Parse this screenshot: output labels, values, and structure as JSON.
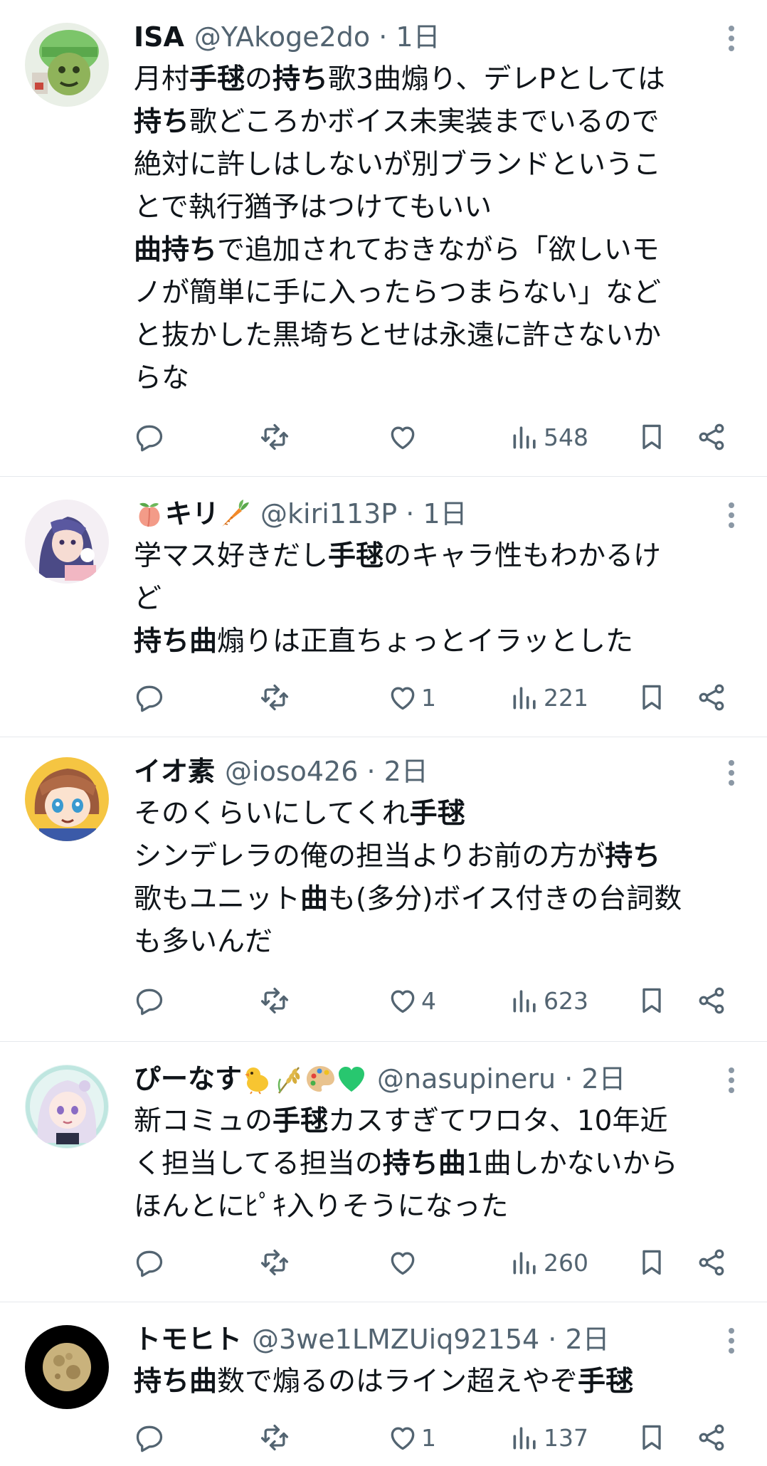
{
  "posts": [
    {
      "name": "ISA",
      "handle": "@YAkoge2do",
      "time": "1日",
      "text_lines": [
        [
          {
            "t": "月村"
          },
          {
            "t": "手毬",
            "b": true
          },
          {
            "t": "の"
          },
          {
            "t": "持ち",
            "b": true
          },
          {
            "t": "歌3曲煽り、デレPとしては"
          }
        ],
        [
          {
            "t": "持ち",
            "b": true
          },
          {
            "t": "歌どころかボイス未実装までいるので"
          }
        ],
        [
          {
            "t": "絶対に許しはしないが別ブランドというこ"
          }
        ],
        [
          {
            "t": "とで執行猶予はつけてもいい"
          }
        ],
        [
          {
            "t": "曲持ち",
            "b": true
          },
          {
            "t": "で追加されておきながら「欲しいモ"
          }
        ],
        [
          {
            "t": "ノが簡単に手に入ったらつまらない」など"
          }
        ],
        [
          {
            "t": "と抜かした黒埼ちとせは永遠に許さないか"
          }
        ],
        [
          {
            "t": "らな"
          }
        ]
      ],
      "likes": "",
      "views": "548"
    },
    {
      "name": "キリ",
      "name_prefix_emoji": "peach-emoji",
      "name_suffix_emoji": "carrot-emoji",
      "handle": "@kiri113P",
      "time": "1日",
      "text_lines": [
        [
          {
            "t": "学マス好きだし"
          },
          {
            "t": "手毬",
            "b": true
          },
          {
            "t": "のキャラ性もわかるけ"
          }
        ],
        [
          {
            "t": "ど"
          }
        ],
        [
          {
            "t": "持ち曲",
            "b": true
          },
          {
            "t": "煽りは正直ちょっとイラッとした"
          }
        ]
      ],
      "likes": "1",
      "views": "221"
    },
    {
      "name": "イオ素",
      "handle": "@ioso426",
      "time": "2日",
      "text_lines": [
        [
          {
            "t": "そのくらいにしてくれ"
          },
          {
            "t": "手毬",
            "b": true
          }
        ],
        [
          {
            "t": "シンデレラの俺の担当よりお前の方が"
          },
          {
            "t": "持ち",
            "b": true
          }
        ],
        [
          {
            "t": "歌もユニット"
          },
          {
            "t": "曲",
            "b": true
          },
          {
            "t": "も(多分)ボイス付きの台詞数"
          }
        ],
        [
          {
            "t": "も多いんだ"
          }
        ]
      ],
      "likes": "4",
      "views": "623"
    },
    {
      "name": "ぴーなす",
      "name_suffix_emojis": [
        "chick-emoji",
        "rice-emoji",
        "palette-emoji",
        "green-heart-emoji"
      ],
      "handle": "@nasupineru",
      "time": "2日",
      "text_lines": [
        [
          {
            "t": "新コミュの"
          },
          {
            "t": "手毬",
            "b": true
          },
          {
            "t": "カスすぎてワロタ、10年近"
          }
        ],
        [
          {
            "t": "く担当してる担当の"
          },
          {
            "t": "持ち曲",
            "b": true
          },
          {
            "t": "1曲しかないから"
          }
        ],
        [
          {
            "t": "ほんとにﾋﾟｷ入りそうになった"
          }
        ]
      ],
      "likes": "",
      "views": "260"
    },
    {
      "name": "トモヒト",
      "handle": "@3we1LMZUiq92154",
      "time": "2日",
      "text_lines": [
        [
          {
            "t": "持ち曲",
            "b": true
          },
          {
            "t": "数で煽るのはライン超えやぞ"
          },
          {
            "t": "手毬",
            "b": true
          }
        ]
      ],
      "likes": "1",
      "views": "137"
    }
  ],
  "colors": {
    "text": "#0f1419",
    "secondary": "#536471",
    "divider": "#e6e9ec"
  },
  "icons": [
    "reply-icon",
    "retweet-icon",
    "like-icon",
    "views-icon",
    "bookmark-icon",
    "share-icon",
    "more-icon"
  ]
}
